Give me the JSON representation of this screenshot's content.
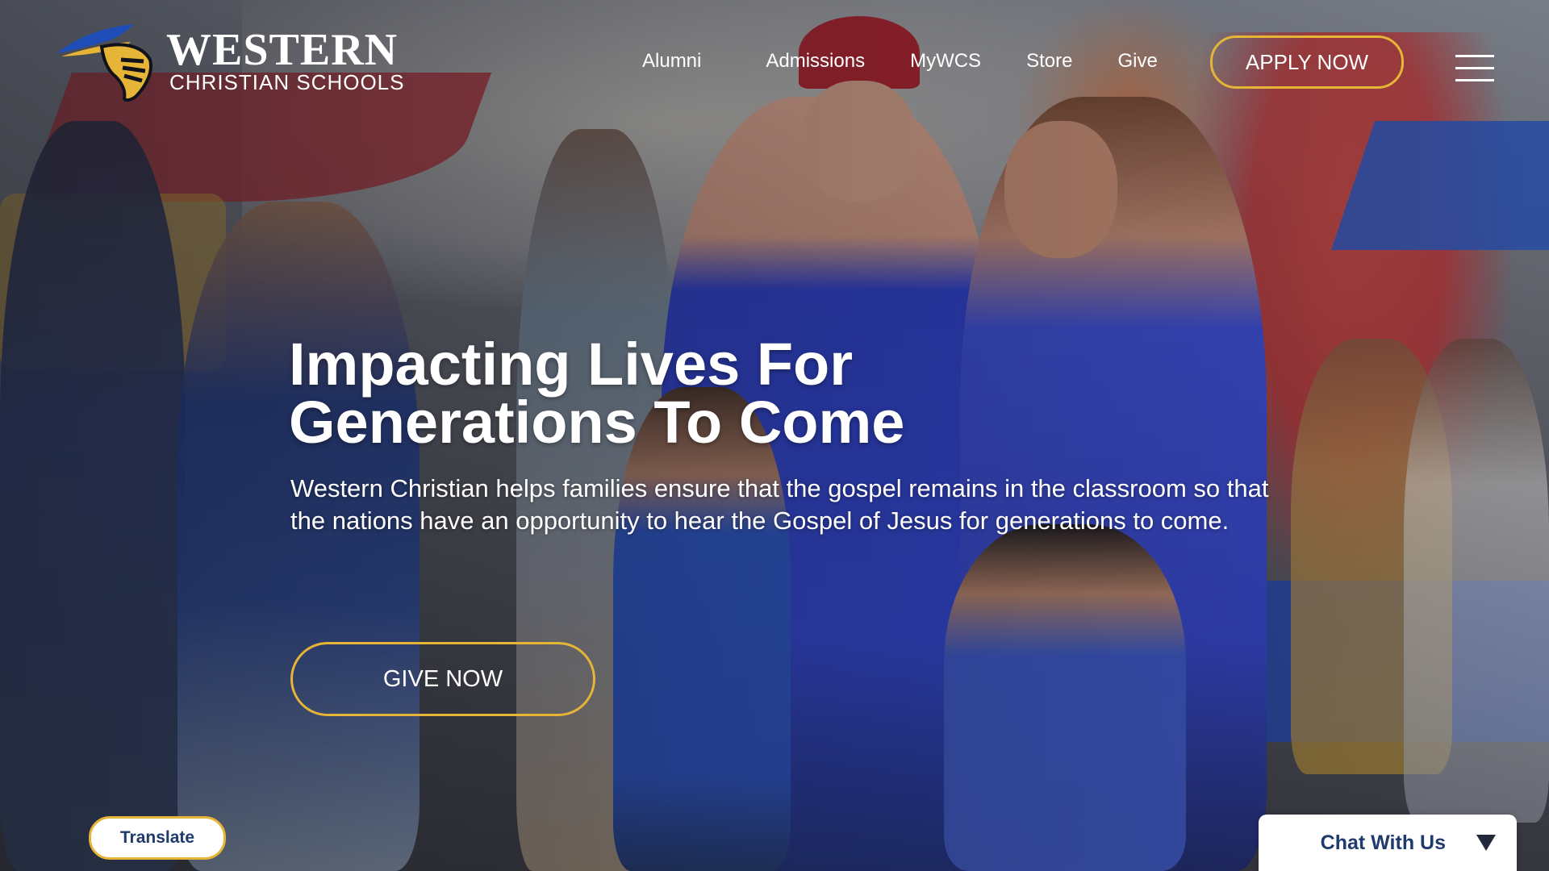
{
  "header": {
    "logo": {
      "line1": "WESTERN",
      "line2": "CHRISTIAN SCHOOLS"
    },
    "nav": [
      {
        "label": "Alumni"
      },
      {
        "label": "Admissions"
      },
      {
        "label": "MyWCS"
      },
      {
        "label": "Store"
      },
      {
        "label": "Give"
      }
    ],
    "apply_label": "APPLY NOW",
    "menu_icon": "hamburger-menu-icon"
  },
  "hero": {
    "headline_line1": "Impacting Lives For",
    "headline_line2": "Generations To Come",
    "subcopy": "Western Christian helps families ensure that the gospel remains in the classroom so that the nations have an opportunity to hear the Gospel of Jesus for generations to come.",
    "give_label": "GIVE NOW"
  },
  "widgets": {
    "translate_label": "Translate",
    "chat_label": "Chat With Us",
    "chat_icon": "chevron-down-triangle-icon"
  },
  "colors": {
    "accent_gold": "#e6b436",
    "navy_text": "#1f3a6e",
    "white": "#ffffff"
  }
}
